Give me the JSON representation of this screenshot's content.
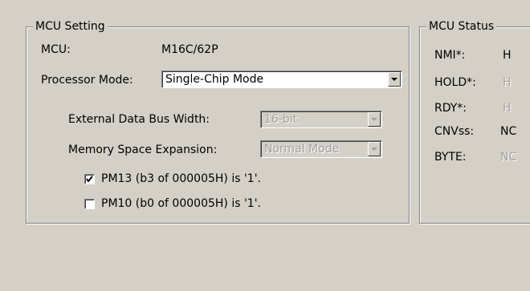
{
  "mcu_setting": {
    "title": "MCU Setting",
    "mcu_label": "MCU:",
    "mcu_value": "M16C/62P",
    "processor_mode_label": "Processor Mode:",
    "processor_mode_value": "Single-Chip Mode",
    "ext_bus_label": "External Data Bus Width:",
    "ext_bus_value": "16-bit",
    "mem_exp_label": "Memory Space Expansion:",
    "mem_exp_value": "Normal Mode",
    "pm13_label": "PM13 (b3 of 000005H) is '1'.",
    "pm13_checked": true,
    "pm10_label": "PM10 (b0 of 000005H) is '1'.",
    "pm10_checked": false
  },
  "mcu_status": {
    "title": "MCU Status",
    "rows": [
      {
        "label": "NMI*:",
        "value": "H",
        "active": true
      },
      {
        "label": "HOLD*:",
        "value": "H",
        "active": false
      },
      {
        "label": "RDY*:",
        "value": "H",
        "active": false
      },
      {
        "label": "CNVss:",
        "value": "NC",
        "active": true
      },
      {
        "label": "BYTE:",
        "value": "NC",
        "active": false
      }
    ]
  }
}
